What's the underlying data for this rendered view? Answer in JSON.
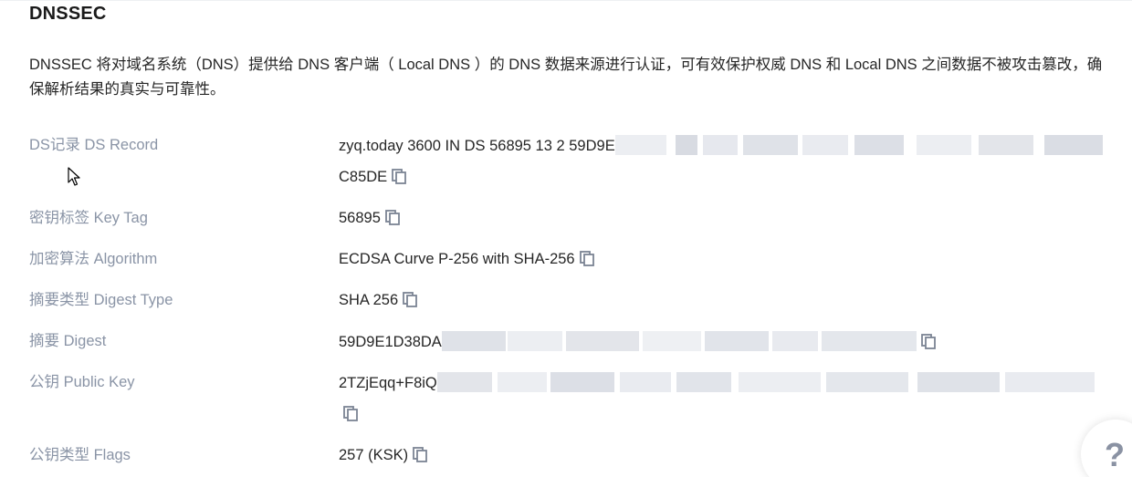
{
  "section": {
    "title": "DNSSEC",
    "description": "DNSSEC 将对域名系统（DNS）提供给 DNS 客户端（ Local DNS ）的 DNS 数据来源进行认证，可有效保护权威 DNS 和 Local DNS 之间数据不被攻击篡改，确保解析结果的真实与可靠性。"
  },
  "rows": {
    "ds_record": {
      "label": "DS记录 DS Record",
      "value_line1": "zyq.today 3600 IN DS 56895 13 2 59D9E",
      "value_line2": "C85DE"
    },
    "key_tag": {
      "label": "密钥标签 Key Tag",
      "value": "56895"
    },
    "algorithm": {
      "label": "加密算法 Algorithm",
      "value": "ECDSA Curve P-256 with SHA-256"
    },
    "digest_type": {
      "label": "摘要类型 Digest Type",
      "value": "SHA 256"
    },
    "digest": {
      "label": "摘要 Digest",
      "value": "59D9E1D38DA"
    },
    "public_key": {
      "label": "公钥 Public Key",
      "value": "2TZjEqq+F8iQ"
    },
    "flags": {
      "label": "公钥类型 Flags",
      "value": "257 (KSK)"
    }
  },
  "icons": {
    "copy": "copy-icon",
    "help": "question-mark-icon",
    "cursor": "mouse-pointer-icon"
  },
  "help": {
    "symbol": "?"
  },
  "colors": {
    "label": "#8a94a6",
    "text": "#262626",
    "icon": "#7b8494"
  }
}
